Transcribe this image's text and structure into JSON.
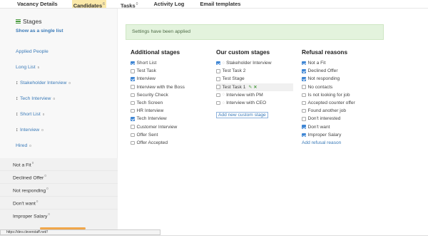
{
  "nav": {
    "tabs": [
      {
        "label": "Vacancy Details",
        "badge": ""
      },
      {
        "label": "Candidates",
        "badge": "6"
      },
      {
        "label": "Tasks",
        "badge": "0"
      },
      {
        "label": "Activity Log",
        "badge": ""
      },
      {
        "label": "Email templates",
        "badge": ""
      }
    ],
    "active_index": 1
  },
  "sidebar": {
    "title": "Stages",
    "show_single_list": "Show as a single list",
    "stages": [
      {
        "label": "Applied People",
        "badge": ""
      },
      {
        "label": "Long List",
        "badge": "5"
      },
      {
        "label": "Stakeholder Interview",
        "badge": "0"
      },
      {
        "label": "Tech Interview",
        "badge": "0"
      },
      {
        "label": "Short List",
        "badge": "0"
      },
      {
        "label": "Interview",
        "badge": "0"
      },
      {
        "label": "Hired",
        "badge": "0"
      }
    ],
    "refusals": [
      {
        "label": "Not a Fit",
        "badge": "0"
      },
      {
        "label": "Declined Offer",
        "badge": "0"
      },
      {
        "label": "Not responding",
        "badge": "0"
      },
      {
        "label": "Don't want",
        "badge": "0"
      },
      {
        "label": "Improper Salary",
        "badge": "0"
      }
    ]
  },
  "alert": {
    "text": "Settings have been applied"
  },
  "additional_stages": {
    "title": "Additional stages",
    "items": [
      {
        "label": "Short List",
        "checked": true
      },
      {
        "label": "Test Task",
        "checked": false
      },
      {
        "label": "Interview",
        "checked": true
      },
      {
        "label": "Interview with the Boss",
        "checked": false
      },
      {
        "label": "Security Check",
        "checked": false
      },
      {
        "label": "Tech Screen",
        "checked": false
      },
      {
        "label": "HR Interview",
        "checked": false
      },
      {
        "label": "Tech Interview",
        "checked": true
      },
      {
        "label": "Customer Interview",
        "checked": false
      },
      {
        "label": "Offer Sent",
        "checked": false
      },
      {
        "label": "Offer Accepted",
        "checked": false
      }
    ]
  },
  "custom_stages": {
    "title": "Our custom stages",
    "items": [
      {
        "label": "Stakeholder Interview",
        "checked": true,
        "chat": true
      },
      {
        "label": "Test Task 2",
        "checked": false,
        "chat": false
      },
      {
        "label": "Test Stage",
        "checked": false,
        "chat": false
      },
      {
        "label": "Test Task 1",
        "checked": false,
        "chat": false,
        "highlight": true
      },
      {
        "label": "Interview with PM",
        "checked": false,
        "chat": true
      },
      {
        "label": "Interview with CEO",
        "checked": false,
        "chat": true
      }
    ],
    "add_link": "Add new custom stage"
  },
  "refusal_reasons": {
    "title": "Refusal reasons",
    "items": [
      {
        "label": "Not a Fit",
        "checked": true
      },
      {
        "label": "Declined Offer",
        "checked": true
      },
      {
        "label": "Not responding",
        "checked": true
      },
      {
        "label": "No contacts",
        "checked": false
      },
      {
        "label": "Is not looking for job",
        "checked": false
      },
      {
        "label": "Accepted counter offer",
        "checked": false
      },
      {
        "label": "Found another job",
        "checked": false
      },
      {
        "label": "Don't interested",
        "checked": false
      },
      {
        "label": "Don't want",
        "checked": true
      },
      {
        "label": "Improper Salary",
        "checked": true
      }
    ],
    "add_link": "Add refusal reason"
  },
  "status_url": "https://dev.cleverstaff.net/!",
  "colors": {
    "accent": "#3a7ab8",
    "checkbox": "#3f86d4",
    "alert_bg": "#e3f3dd",
    "active_tab": "#fbe9a9"
  }
}
